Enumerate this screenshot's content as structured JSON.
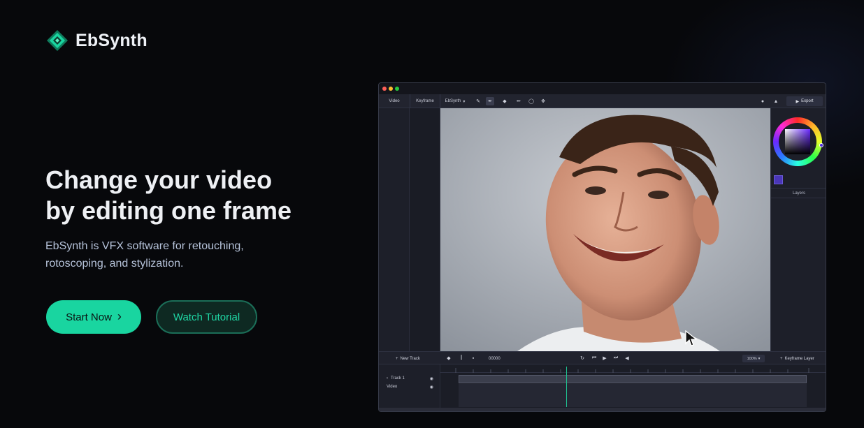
{
  "brand": {
    "name": "EbSynth",
    "accent": "#19d5a0"
  },
  "hero": {
    "title_line1": "Change your video",
    "title_line2": "by editing one frame",
    "subtitle_line1": "EbSynth is VFX software for retouching,",
    "subtitle_line2": "rotoscoping, and stylization.",
    "primary_button": "Start Now",
    "secondary_button": "Watch Tutorial"
  },
  "app": {
    "tabs": [
      "Video",
      "Keyframe"
    ],
    "mode_select": "EbSynth",
    "export_label": "Export",
    "layers_label": "Layers",
    "new_track_label": "New Track",
    "frame_counter": "00000",
    "zoom_level": "100%",
    "keyframe_layer_label": "Keyframe Layer",
    "tracks": [
      "Track 1",
      "Video"
    ],
    "toolbar_icons": [
      "brush-icon",
      "pen-icon",
      "eraser-icon",
      "pencil-icon",
      "lasso-icon",
      "hand-icon"
    ],
    "status_colors": {
      "close": "#ff5f57",
      "minimize": "#febc2e",
      "maximize": "#28c840"
    }
  }
}
